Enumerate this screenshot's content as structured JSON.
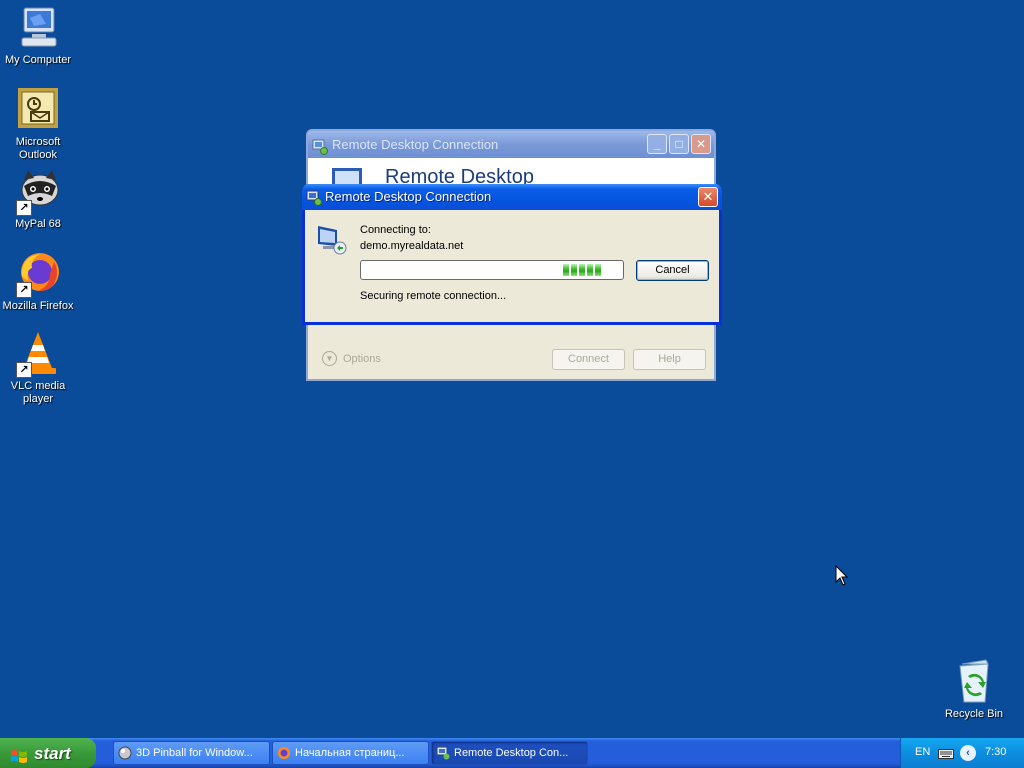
{
  "desktop": {
    "icons": [
      {
        "label": "My Computer"
      },
      {
        "label": "Microsoft Outlook"
      },
      {
        "label": "MyPal 68"
      },
      {
        "label": "Mozilla Firefox"
      },
      {
        "label": "VLC media player"
      },
      {
        "label": "Recycle Bin"
      }
    ]
  },
  "back_window": {
    "title": "Remote Desktop Connection",
    "banner": "Remote Desktop",
    "options_label": "Options",
    "connect_label": "Connect",
    "help_label": "Help",
    "minimize_icon": "minimize-icon",
    "maximize_icon": "maximize-icon",
    "close_icon": "close-icon"
  },
  "dialog": {
    "title": "Remote Desktop Connection",
    "connecting_to": "Connecting to:",
    "host": "demo.myrealdata.net",
    "status": "Securing remote connection...",
    "cancel_label": "Cancel",
    "progress_chunks": 5
  },
  "taskbar": {
    "start_label": "start",
    "tasks": [
      {
        "label": "3D Pinball for Window..."
      },
      {
        "label": "Начальная страниц..."
      },
      {
        "label": "Remote Desktop Con..."
      }
    ],
    "active_task": 2,
    "tray": {
      "language": "EN",
      "clock": "7:30"
    }
  },
  "colors": {
    "desktop": "#0a4c9a",
    "titlebar_active": "#0555e0",
    "taskbar": "#245edb",
    "start": "#3a9a3a"
  }
}
